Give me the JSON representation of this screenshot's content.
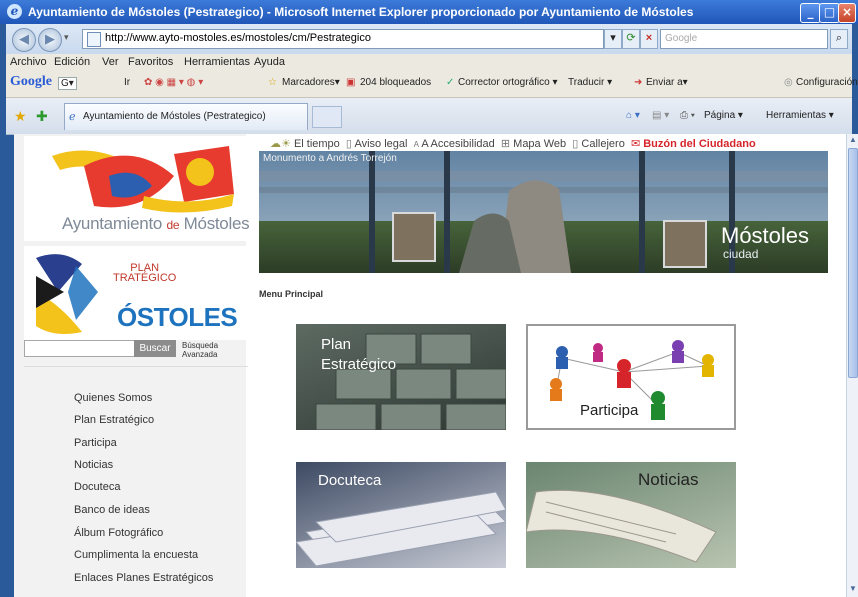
{
  "window": {
    "title": "Ayuntamiento de Móstoles (Pestrategico) - Microsoft Internet Explorer proporcionado por Ayuntamiento de Móstoles",
    "address_url": "http://www.ayto-mostoles.es/mostoles/cm/Pestrategico",
    "search_placeholder": "Google",
    "menu": [
      "Archivo",
      "Edición",
      "Ver",
      "Favoritos",
      "Herramientas",
      "Ayuda"
    ],
    "google_toolbar": {
      "logo": "Google",
      "go_label": "G▾",
      "ir_label": "Ir",
      "marcadores": "Marcadores▾",
      "bloqueados": "204 bloqueados",
      "corrector": "Corrector ortográfico ▾",
      "traducir": "Traducir ▾",
      "enviar": "Enviar a▾",
      "configuracion": "Configuración▾"
    },
    "tab_title": "Ayuntamiento de Móstoles (Pestrategico)",
    "command_bar": {
      "pagina": "Página ▾",
      "herramientas": "Herramientas ▾"
    }
  },
  "page": {
    "logo_text_1": "Ayuntamiento",
    "logo_text_de": "de",
    "logo_text_2": "Móstoles",
    "plan_title_line1": "PLAN",
    "plan_title_line2": "TRATÉGICO",
    "plan_city": "ÓSTOLES",
    "search_button": "Buscar",
    "advanced_search_1": "Búsqueda",
    "advanced_search_2": "Avanzada",
    "top_links": {
      "tiempo": "El tiempo",
      "aviso": "Aviso legal",
      "accesibilidad": "A Accesibilidad",
      "mapa": "Mapa Web",
      "callejero": "Callejero",
      "buzon": "Buzón del Ciudadano"
    },
    "banner_caption": "Monumento a Andrés Torrejón",
    "banner_city": "Móstoles",
    "banner_city_sub": "ciudad",
    "menu_principal": "Menu Principal",
    "nav": [
      "Quienes Somos",
      "Plan Estratégico",
      "Participa",
      "Noticias",
      "Docuteca",
      "Banco de ideas",
      "Álbum Fotográfico",
      "Cumplimenta la encuesta",
      "Enlaces Planes Estratégicos"
    ],
    "tiles": {
      "plan_line1": "Plan",
      "plan_line2": "Estratégico",
      "participa": "Participa",
      "docuteca": "Docuteca",
      "noticias": "Noticias"
    }
  },
  "colors": {
    "buzon": "#d6242b",
    "plan_red": "#c0392b",
    "plan_blue": "#1e73be"
  }
}
